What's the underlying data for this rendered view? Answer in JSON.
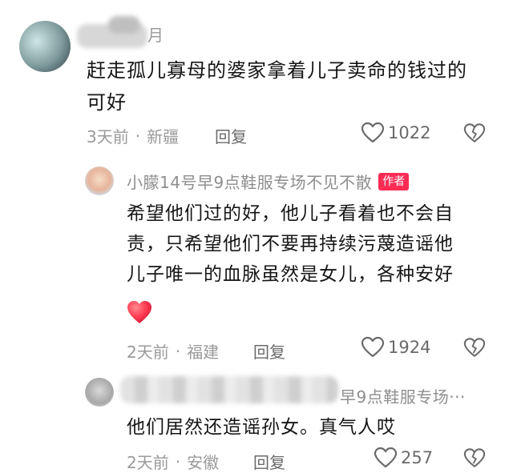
{
  "comments": [
    {
      "name_visible": "",
      "text_line1": "赶走孤儿寡母的婆家拿着儿子卖命的钱过的",
      "text_line2": "可好",
      "time": "3天前",
      "location": "新疆",
      "reply_label": "回复",
      "likes": "1022"
    }
  ],
  "author_reply": {
    "name": "小朦14号早9点鞋服专场不见不散",
    "badge": "作者",
    "text_line1": "希望他们过的好，他儿子看着也不会自",
    "text_line2": "责，只希望他们不要再持续污蔑造谣他",
    "text_line3": "儿子唯一的血脉虽然是女儿，各种安好",
    "time": "2天前",
    "location": "福建",
    "reply_label": "回复",
    "likes": "1924"
  },
  "second_reply": {
    "name_partial": "早9点鞋服专场···",
    "text": "他们居然还造谣孙女。真气人哎",
    "time": "2天前",
    "location": "安徽",
    "reply_label": "回复",
    "likes": "257"
  },
  "meta": {
    "separator": "·"
  },
  "colors": {
    "accent": "#fe2c55",
    "heart_emoji": "#ff3b52"
  },
  "icons": [
    "heart-outline-icon",
    "dislike-heart-icon",
    "heart-emoji-icon"
  ]
}
